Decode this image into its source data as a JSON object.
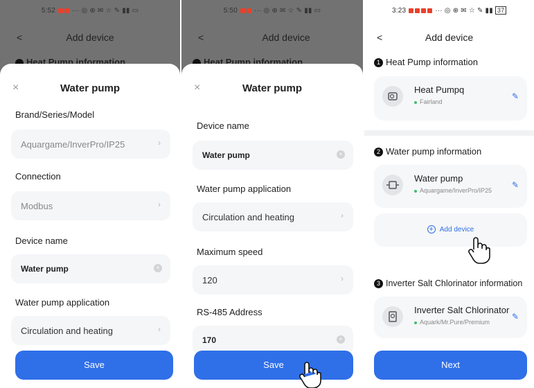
{
  "panel1": {
    "status_time": "5:52",
    "nav_title": "Add device",
    "nav_back": "<",
    "behind_text": "Heat Pump information",
    "sheet_title": "Water pump",
    "close": "×",
    "fields": [
      {
        "label": "Brand/Series/Model",
        "value": "Aquargame/InverPro/IP25",
        "type": "select"
      },
      {
        "label": "Connection",
        "value": "Modbus",
        "type": "select"
      },
      {
        "label": "Device name",
        "value": "Water pump",
        "type": "text"
      },
      {
        "label": "Water pump application",
        "value": "Circulation and heating",
        "type": "select"
      }
    ],
    "save_label": "Save"
  },
  "panel2": {
    "status_time": "5:50",
    "nav_title": "Add device",
    "nav_back": "<",
    "behind_text": "Heat Pump information",
    "sheet_title": "Water pump",
    "close": "×",
    "fields": [
      {
        "label": "Device name",
        "value": "Water pump",
        "type": "text"
      },
      {
        "label": "Water pump application",
        "value": "Circulation and heating",
        "type": "select"
      },
      {
        "label": "Maximum speed",
        "value": "120",
        "type": "select"
      },
      {
        "label": "RS-485 Address",
        "value": "170",
        "type": "text"
      }
    ],
    "save_label": "Save"
  },
  "panel3": {
    "status_time": "3:23",
    "status_battery": "37",
    "nav_title": "Add device",
    "nav_back": "<",
    "sections": [
      {
        "num": "1",
        "title": "Heat Pump information",
        "device": "Heat Pumpq",
        "brand": "Fairland"
      },
      {
        "num": "2",
        "title": "Water pump information",
        "device": "Water pump",
        "brand": "Aquargame/InverPro/IP25"
      },
      {
        "num": "3",
        "title": "Inverter Salt Chlorinator information",
        "device": "Inverter Salt Chlorinator",
        "brand": "Aquark/Mr.Pure/Premium"
      }
    ],
    "add_device_label": "Add device",
    "next_label": "Next"
  },
  "colors": {
    "accent": "#2f6fe8",
    "overlay": "#727272",
    "field_bg": "#f5f6f8"
  }
}
